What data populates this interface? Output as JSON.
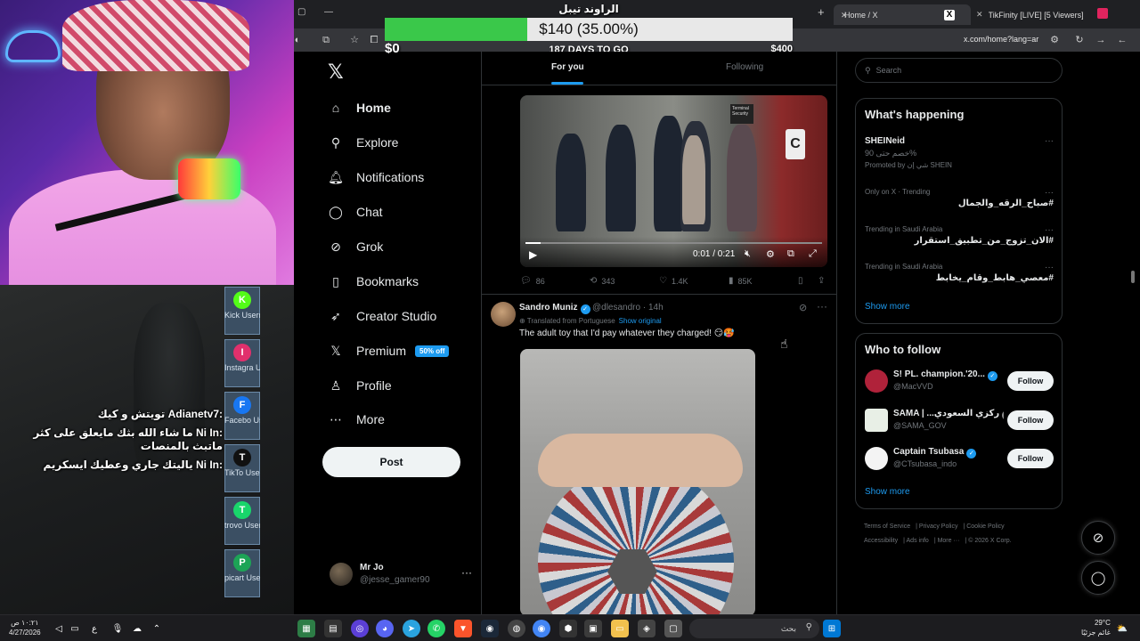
{
  "stream": {
    "chat": [
      {
        "user": "Adianetv7",
        "text": "تويتش و كيك"
      },
      {
        "user": "Ni In",
        "text": "ما شاء الله بثك مايعلق على كثر ماتبث بالمنصات"
      },
      {
        "user": "Ni In",
        "text": "ياليتك جاري وعطيك ايسكريم"
      }
    ],
    "chat_display": [
      ":Adianetv7 تويتش و كيك",
      ":Ni In ما شاء الله بثك مايعلق على كثر ماتبث بالمنصات",
      ":Ni In ياليتك جاري وعطيك ايسكريم"
    ],
    "socials": [
      {
        "name": "Kick",
        "label": "Kick Userna",
        "icon": "kick-icon",
        "color": "#53fc18"
      },
      {
        "name": "Instagram",
        "label": "Instagra Userna",
        "icon": "instagram-icon",
        "color": "#e1306c"
      },
      {
        "name": "Facebook",
        "label": "Facebo Userna",
        "icon": "facebook-icon",
        "color": "#1877f2"
      },
      {
        "name": "TikTok",
        "label": "TikTo Userna",
        "icon": "tiktok-icon",
        "color": "#111111"
      },
      {
        "name": "Trovo",
        "label": "trovo Userna",
        "icon": "trovo-icon",
        "color": "#19d66b"
      },
      {
        "name": "Picarto",
        "label": "picart Userna",
        "icon": "picarto-icon",
        "color": "#1da456"
      }
    ]
  },
  "goal": {
    "title": "الراوند تيبل",
    "amount": "$140 (35.00%)",
    "progress": 0.35,
    "min": "$0",
    "max": "$400",
    "days": "187 DAYS TO GO"
  },
  "browser": {
    "tabs": [
      {
        "label": "Home / X",
        "active": true
      },
      {
        "label": "TikFinity [LIVE] [5 Viewers]",
        "active": false
      }
    ],
    "url": "x.com/home?lang=ar"
  },
  "nav": {
    "items": [
      {
        "key": "home",
        "label": "Home",
        "icon": "home-icon",
        "glyph": "⌂"
      },
      {
        "key": "explore",
        "label": "Explore",
        "icon": "search-icon",
        "glyph": "⚲"
      },
      {
        "key": "notifications",
        "label": "Notifications",
        "icon": "bell-icon",
        "glyph": "🔔︎"
      },
      {
        "key": "chat",
        "label": "Chat",
        "icon": "chat-bubble-icon",
        "glyph": "◯"
      },
      {
        "key": "grok",
        "label": "Grok",
        "icon": "grok-icon",
        "glyph": "⊘"
      },
      {
        "key": "bookmarks",
        "label": "Bookmarks",
        "icon": "bookmark-icon",
        "glyph": "▯"
      },
      {
        "key": "creator",
        "label": "Creator Studio",
        "icon": "rocket-icon",
        "glyph": "➶"
      },
      {
        "key": "premium",
        "label": "Premium",
        "icon": "x-logo-icon",
        "glyph": "𝕏"
      },
      {
        "key": "profile",
        "label": "Profile",
        "icon": "person-icon",
        "glyph": "♙"
      },
      {
        "key": "more",
        "label": "More",
        "icon": "more-circle-icon",
        "glyph": "⋯"
      }
    ],
    "premium_badge": "50% off",
    "post_label": "Post",
    "me": {
      "name": "Mr Jo",
      "handle": "@jesse_gamer90"
    }
  },
  "feed": {
    "tabs": [
      {
        "label": "For you",
        "selected": true
      },
      {
        "label": "Following",
        "selected": false
      }
    ],
    "video1": {
      "time": "0:01 / 0:21",
      "progress": 0.05,
      "door_letter": "C",
      "sign": "Terminal Security",
      "actions": {
        "replies": "86",
        "reposts": "343",
        "likes": "1.4K",
        "views": "85K"
      }
    },
    "tweet2": {
      "name": "Sandro Muniz",
      "handle": "@dlesandro · 14h",
      "translated": "Translated from Portuguese",
      "show_original": "Show original",
      "text": "The adult toy that I'd pay whatever they charged! 😏🥵"
    }
  },
  "right": {
    "search_placeholder": "Search",
    "happening_title": "What's happening",
    "trends": [
      {
        "meta": "",
        "title": "SHEINeid",
        "sub": "خصم حتى 90%",
        "sub2": "Promoted by شي إن SHEIN",
        "rtl": false
      },
      {
        "meta": "Only on X · Trending",
        "title": "#صباح_الرقه_والجمال",
        "rtl": true
      },
      {
        "meta": "Trending in Saudi Arabia",
        "title": "#الان_تزوج_من_تطبيق_استقرار",
        "rtl": true
      },
      {
        "meta": "Trending in Saudi Arabia",
        "title": "#معصي_هابط_وقام_يخابط",
        "rtl": true
      }
    ],
    "show_more": "Show more",
    "who_title": "Who to follow",
    "who": [
      {
        "name": "S! PL. champion.'20...",
        "handle": "@MacVVD",
        "color": "#b0223a"
      },
      {
        "name": "SAMA | ...ركزي السعودي",
        "handle": "@SAMA_GOV",
        "color": "#e8efe6"
      },
      {
        "name": "Captain Tsubasa",
        "handle": "@CTsubasa_indo",
        "color": "#f4f4f4"
      }
    ],
    "follow_label": "Follow",
    "footer": [
      "Terms of Service",
      "Privacy Policy",
      "Cookie Policy",
      "Accessibility",
      "Ads info",
      "More ···",
      "© 2026 X Corp."
    ]
  },
  "taskbar": {
    "time": "١٠:٢١ ص",
    "date": "4/27/2026",
    "lang": "ع",
    "search_label": "بحث",
    "weather_temp": "29°C",
    "weather_desc": "غائم جزئيًا"
  },
  "colors": {
    "accent": "#1d9bf0",
    "goal_fill": "#3ac84a",
    "text": "#e7e9ea",
    "muted": "#71767b"
  }
}
